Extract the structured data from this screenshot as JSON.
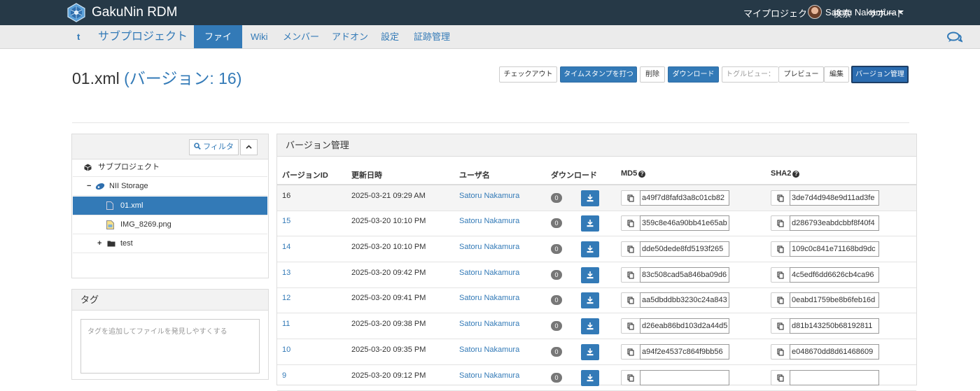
{
  "app": {
    "name": "GakuNin RDM"
  },
  "topnav": {
    "my_projects": "マイプロジェクト",
    "search": "検索",
    "support": "サポート",
    "user_name": "Satoru Nakamura"
  },
  "subnav": {
    "project_initial": "t",
    "project": "サブプロジェクト",
    "tabs": [
      "ファイル",
      "Wiki",
      "メンバー",
      "アドオン",
      "設定",
      "証跡管理"
    ],
    "active_tab": "ファイル"
  },
  "file": {
    "name": "01.xml",
    "version_label": "(バージョン: 16)"
  },
  "actions": {
    "checkout": "チェックアウト",
    "timestamp": "タイムスタンプを打つ",
    "delete": "削除",
    "download": "ダウンロード",
    "toggle_view": "トグルビュー：",
    "preview": "プレビュー",
    "edit": "編集",
    "versions": "バージョン管理"
  },
  "tree": {
    "filter": "フィルタ",
    "items": [
      {
        "label": "サブプロジェクト",
        "type": "project"
      },
      {
        "label": "NII Storage",
        "type": "storage",
        "toggle": "−"
      },
      {
        "label": "01.xml",
        "type": "file",
        "selected": true
      },
      {
        "label": "IMG_8269.png",
        "type": "image"
      },
      {
        "label": "test",
        "type": "folder",
        "toggle": "+"
      }
    ]
  },
  "tags": {
    "title": "タグ",
    "placeholder": "タグを追加してファイルを発見しやすくする"
  },
  "versions": {
    "title": "バージョン管理",
    "columns": [
      "バージョンID",
      "更新日時",
      "ユーザ名",
      "ダウンロード",
      "MD5",
      "SHA2"
    ],
    "rows": [
      {
        "id": "16",
        "date": "2025-03-21 09:29 AM",
        "user": "Satoru Nakamura",
        "downloads": "0",
        "md5": "a49f7d8fafd3a8c01cb82",
        "sha2": "3de7d4d948e9d11ad3fe"
      },
      {
        "id": "15",
        "date": "2025-03-20 10:10 PM",
        "user": "Satoru Nakamura",
        "downloads": "0",
        "md5": "359c8e46a90bb41e65ab",
        "sha2": "d286793eabdcbbf8f40f4"
      },
      {
        "id": "14",
        "date": "2025-03-20 10:10 PM",
        "user": "Satoru Nakamura",
        "downloads": "0",
        "md5": "dde50dede8fd5193f265",
        "sha2": "109c0c841e71168bd9dc"
      },
      {
        "id": "13",
        "date": "2025-03-20 09:42 PM",
        "user": "Satoru Nakamura",
        "downloads": "0",
        "md5": "83c508cad5a846ba09d6",
        "sha2": "4c5edf6dd6626cb4ca96"
      },
      {
        "id": "12",
        "date": "2025-03-20 09:41 PM",
        "user": "Satoru Nakamura",
        "downloads": "0",
        "md5": "aa5dbddbb3230c24a843",
        "sha2": "0eabd1759be8b6feb16d"
      },
      {
        "id": "11",
        "date": "2025-03-20 09:38 PM",
        "user": "Satoru Nakamura",
        "downloads": "0",
        "md5": "d26eab86bd103d2a44d5",
        "sha2": "d81b143250b68192811"
      },
      {
        "id": "10",
        "date": "2025-03-20 09:35 PM",
        "user": "Satoru Nakamura",
        "downloads": "0",
        "md5": "a94f2e4537c864f9bb56",
        "sha2": "e048670dd8d61468609"
      },
      {
        "id": "9",
        "date": "2025-03-20 09:12 PM",
        "user": "Satoru Nakamura",
        "downloads": "0",
        "md5": "",
        "sha2": ""
      }
    ]
  },
  "colors": {
    "navbar": "#263947",
    "primary": "#337ab7",
    "subnav_bg": "#ebebeb",
    "badge": "#777777"
  }
}
